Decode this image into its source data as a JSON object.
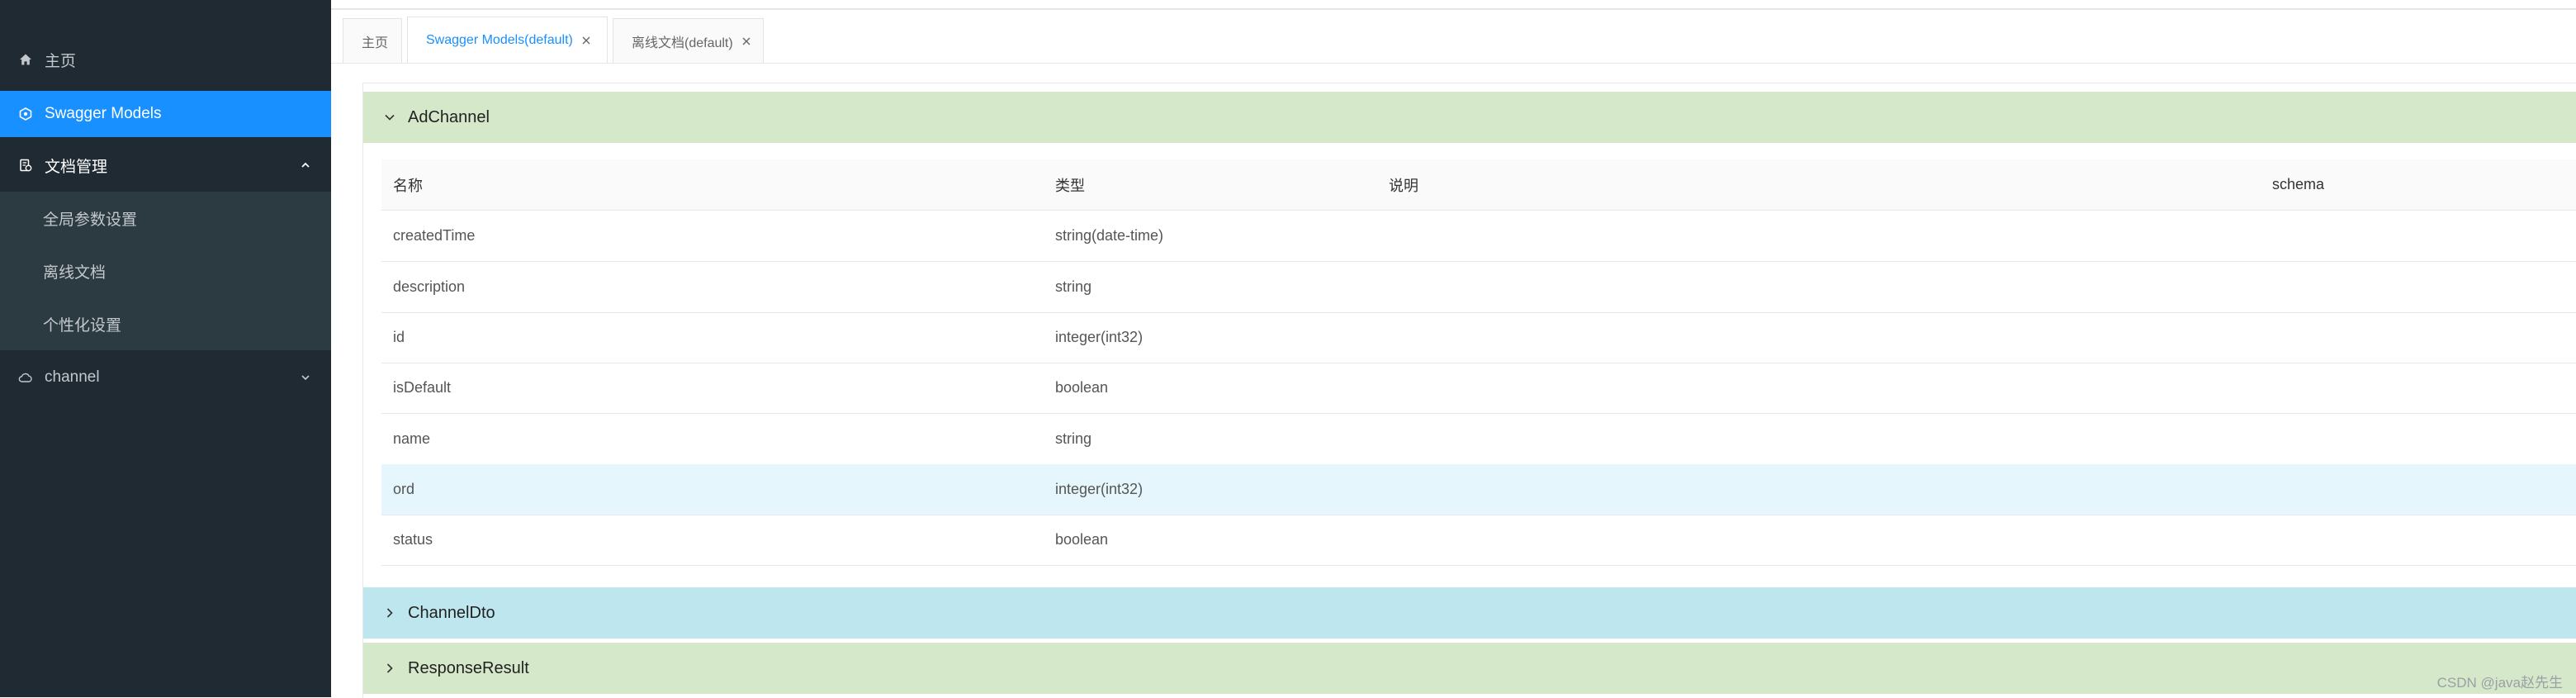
{
  "sidebar": {
    "home": {
      "label": "主页",
      "icon": "home-icon"
    },
    "swagger_models": {
      "label": "Swagger Models",
      "icon": "models-icon"
    },
    "doc_manage": {
      "label": "文档管理",
      "icon": "document-icon",
      "expanded": true,
      "children": [
        {
          "label": "全局参数设置"
        },
        {
          "label": "离线文档"
        },
        {
          "label": "个性化设置"
        }
      ]
    },
    "channel": {
      "label": "channel",
      "icon": "cloud-icon"
    }
  },
  "tabs": [
    {
      "label": "主页",
      "closable": false
    },
    {
      "label": "Swagger Models(default)",
      "closable": true,
      "active": true
    },
    {
      "label": "离线文档(default)",
      "closable": true
    }
  ],
  "panels": {
    "ad_channel": {
      "title": "AdChannel",
      "expanded": true,
      "columns": {
        "name": "名称",
        "type": "类型",
        "desc": "说明",
        "schema": "schema"
      },
      "rows": [
        {
          "name": "createdTime",
          "type": "string(date-time)"
        },
        {
          "name": "description",
          "type": "string"
        },
        {
          "name": "id",
          "type": "integer(int32)"
        },
        {
          "name": "isDefault",
          "type": "boolean"
        },
        {
          "name": "name",
          "type": "string"
        },
        {
          "name": "ord",
          "type": "integer(int32)",
          "highlight": true
        },
        {
          "name": "status",
          "type": "boolean"
        }
      ]
    },
    "channel_dto": {
      "title": "ChannelDto",
      "expanded": false
    },
    "response_result": {
      "title": "ResponseResult",
      "expanded": false
    }
  },
  "colors": {
    "sidebar_bg": "#1f2a33",
    "submenu_bg": "#2c3b41",
    "accent": "#1890ff",
    "panel_green": "#d5e8c9",
    "panel_blue": "#bde6ee",
    "row_highlight": "#e6f6fd"
  },
  "watermark": "CSDN @java赵先生"
}
